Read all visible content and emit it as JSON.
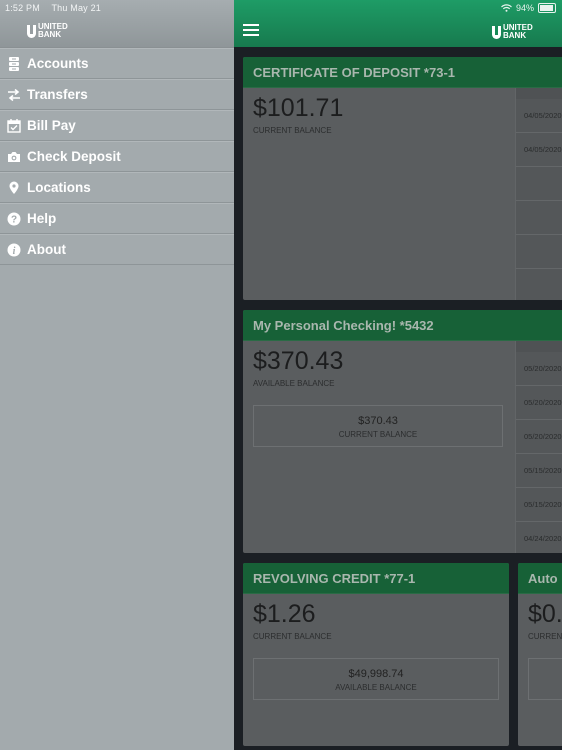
{
  "status_bar": {
    "time": "1:52 PM",
    "date": "Thu May 21",
    "battery": "94%",
    "battery_level": 0.94
  },
  "brand": {
    "line1": "UNITED",
    "line2": "BANK"
  },
  "colors": {
    "accent": "#1b9160",
    "card_header": "#176137",
    "drawer": "#a3aaad"
  },
  "menu": [
    {
      "label": "Accounts",
      "icon": "accounts-icon"
    },
    {
      "label": "Transfers",
      "icon": "transfers-icon"
    },
    {
      "label": "Bill Pay",
      "icon": "calendar-check-icon"
    },
    {
      "label": "Check Deposit",
      "icon": "camera-icon"
    },
    {
      "label": "Locations",
      "icon": "map-pin-icon"
    },
    {
      "label": "Help",
      "icon": "help-icon"
    },
    {
      "label": "About",
      "icon": "info-icon"
    }
  ],
  "accounts": [
    {
      "title": "CERTIFICATE OF DEPOSIT *73-1",
      "balance": "$101.71",
      "balance_label": "CURRENT BALANCE",
      "transactions": [
        "04/05/2020",
        "04/05/2020",
        "",
        "",
        ""
      ]
    },
    {
      "title": "My Personal Checking! *5432",
      "balance": "$370.43",
      "balance_label": "AVAILABLE BALANCE",
      "secondary_value": "$370.43",
      "secondary_label": "CURRENT BALANCE",
      "transactions": [
        "05/20/2020",
        "05/20/2020",
        "05/20/2020",
        "05/15/2020",
        "05/15/2020",
        "04/24/2020"
      ]
    },
    {
      "title": "REVOLVING CREDIT *77-1",
      "balance": "$1.26",
      "balance_label": "CURRENT BALANCE",
      "secondary_value": "$49,998.74",
      "secondary_label": "AVAILABLE BALANCE"
    },
    {
      "title": "Auto",
      "balance": "$0.",
      "balance_label": "CURREN"
    }
  ]
}
